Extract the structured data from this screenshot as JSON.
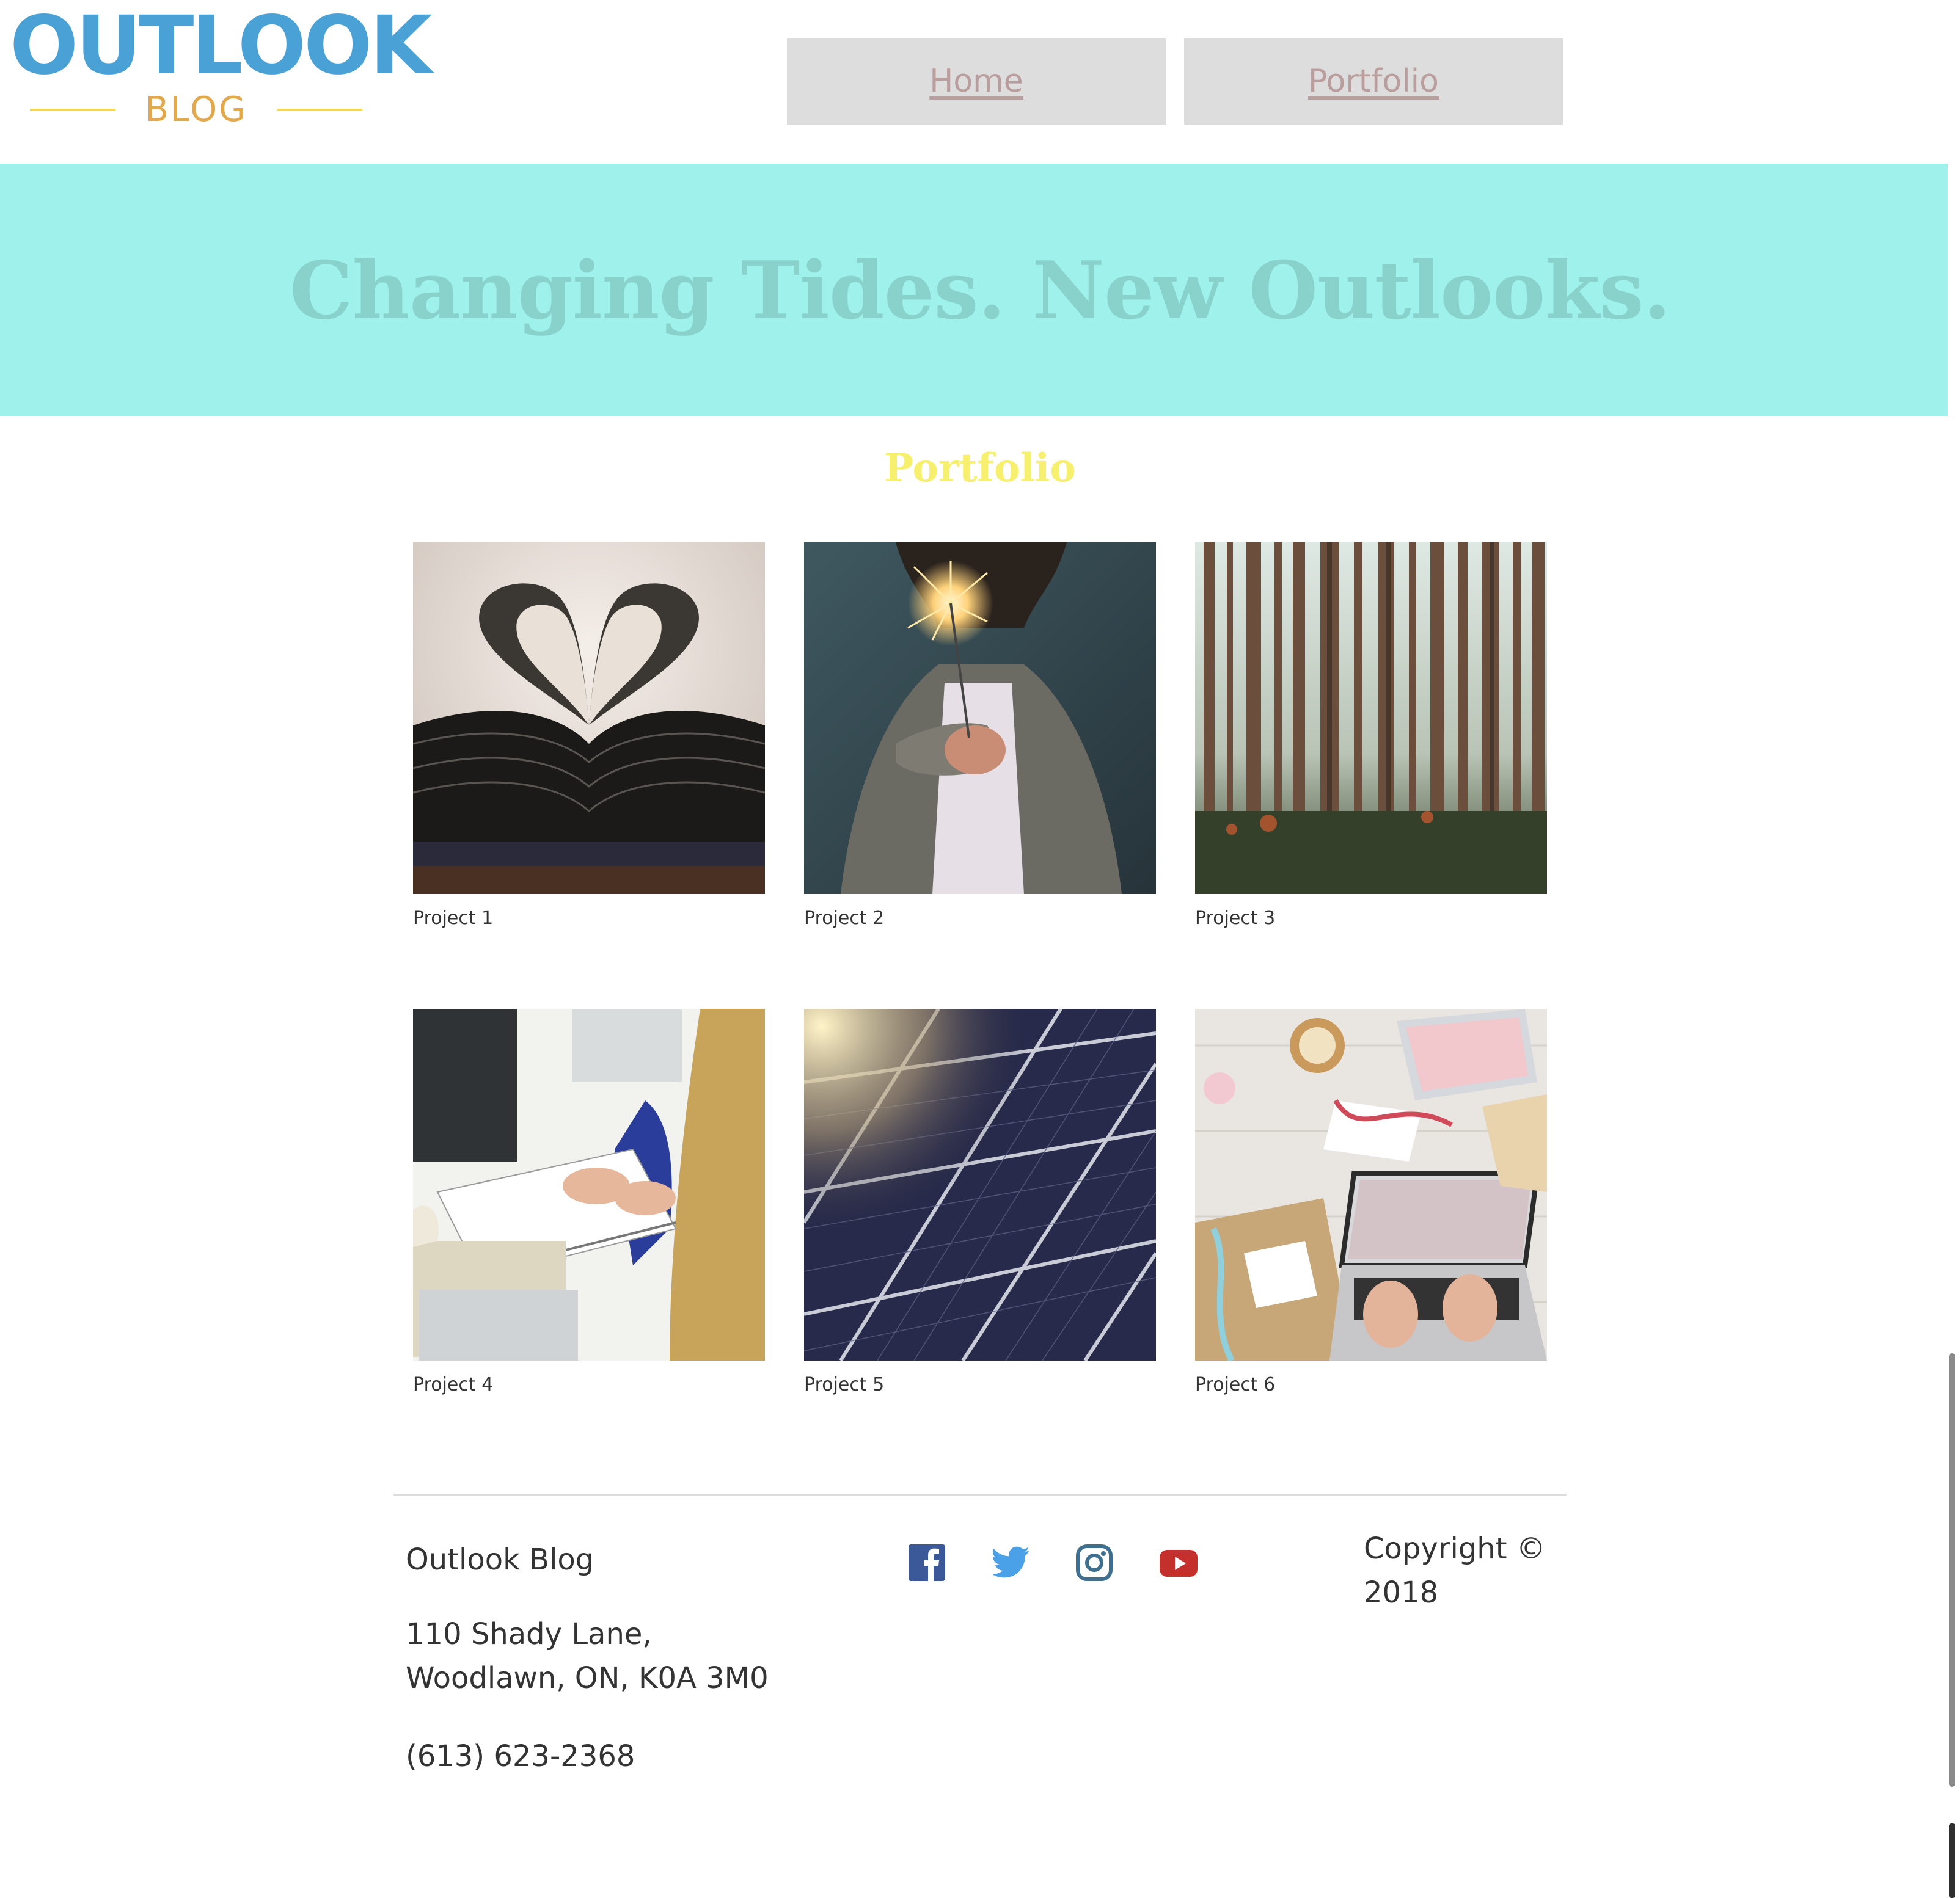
{
  "brand": {
    "logo_title": "OUTLOOK",
    "logo_subtitle": "BLOG",
    "colors": {
      "logo_blue": "#4aa1d6",
      "logo_gold": "#e3a84a",
      "logo_rule": "#f2d65a"
    }
  },
  "nav": {
    "items": [
      {
        "label": "Home"
      },
      {
        "label": "Portfolio"
      }
    ],
    "colors": {
      "background": "#dddddd",
      "text": "#ba9e9e"
    }
  },
  "hero": {
    "title": "Changing Tides. New Outlooks.",
    "colors": {
      "background": "#9ff2ec",
      "text": "#89d2cc"
    }
  },
  "portfolio": {
    "title": "Portfolio",
    "title_color": "#f6f06e",
    "projects": [
      {
        "label": "Project 1",
        "image": "book-heart-photo"
      },
      {
        "label": "Project 2",
        "image": "sparkler-photo"
      },
      {
        "label": "Project 3",
        "image": "forest-photo"
      },
      {
        "label": "Project 4",
        "image": "notebook-writing-photo"
      },
      {
        "label": "Project 5",
        "image": "solar-panels-photo"
      },
      {
        "label": "Project 6",
        "image": "laptop-desk-photo"
      }
    ]
  },
  "footer": {
    "name": "Outlook Blog",
    "address_line1": "110 Shady Lane,",
    "address_line2": "Woodlawn, ON, K0A 3M0",
    "phone": "(613) 623-2368",
    "copyright_line1": "Copyright ©",
    "copyright_line2": "2018",
    "social": [
      {
        "icon": "facebook-icon",
        "color": "#3b5998"
      },
      {
        "icon": "twitter-icon",
        "color": "#4aa1e8"
      },
      {
        "icon": "instagram-icon",
        "color": "#3f6f8f"
      },
      {
        "icon": "youtube-icon",
        "color": "#c4302b"
      }
    ]
  }
}
